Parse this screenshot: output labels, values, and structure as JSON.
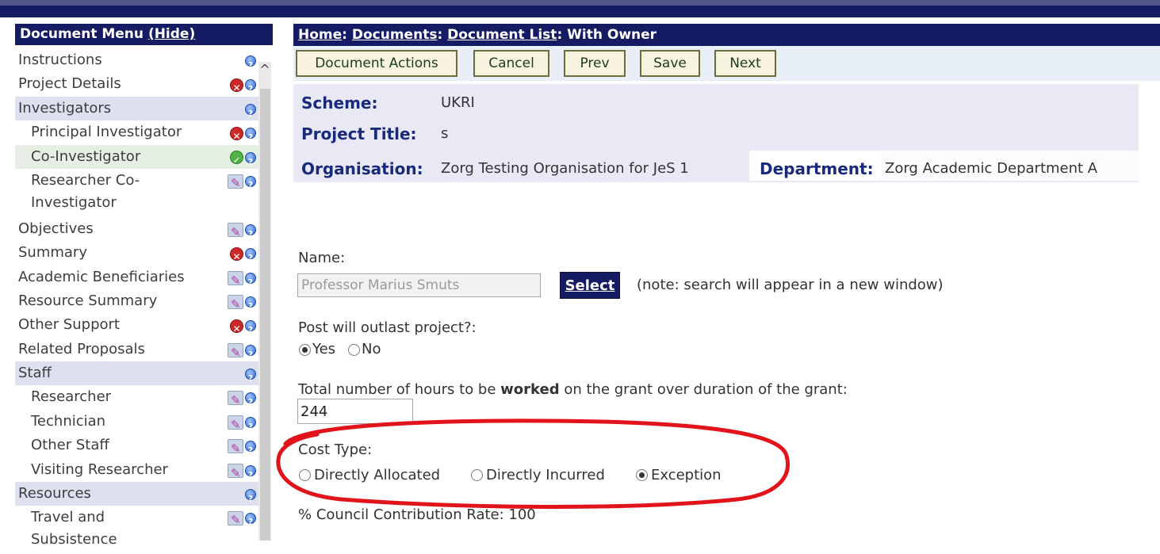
{
  "menu": {
    "header": "Document Menu",
    "hide_link": "(Hide)",
    "items": [
      {
        "label": "Instructions",
        "icons": [
          "help"
        ]
      },
      {
        "label": "Project Details",
        "icons": [
          "error",
          "help"
        ]
      },
      {
        "label": "Investigators",
        "icons": [
          "help"
        ]
      },
      {
        "label": "Principal Investigator",
        "icons": [
          "error",
          "help"
        ]
      },
      {
        "label": "Co-Investigator",
        "icons": [
          "ok",
          "help"
        ]
      },
      {
        "label": "Researcher Co-Investigator",
        "icons": [
          "edit",
          "help"
        ]
      },
      {
        "label": "Objectives",
        "icons": [
          "edit",
          "help"
        ]
      },
      {
        "label": "Summary",
        "icons": [
          "error",
          "help"
        ]
      },
      {
        "label": "Academic Beneficiaries",
        "icons": [
          "edit",
          "help"
        ]
      },
      {
        "label": "Resource Summary",
        "icons": [
          "edit",
          "help"
        ]
      },
      {
        "label": "Other Support",
        "icons": [
          "error",
          "help"
        ]
      },
      {
        "label": "Related Proposals",
        "icons": [
          "edit",
          "help"
        ]
      },
      {
        "label": "Staff",
        "icons": [
          "help"
        ]
      },
      {
        "label": "Researcher",
        "icons": [
          "edit",
          "help"
        ]
      },
      {
        "label": "Technician",
        "icons": [
          "edit",
          "help"
        ]
      },
      {
        "label": "Other Staff",
        "icons": [
          "edit",
          "help"
        ]
      },
      {
        "label": "Visiting Researcher",
        "icons": [
          "edit",
          "help"
        ]
      },
      {
        "label": "Resources",
        "icons": [
          "help"
        ]
      },
      {
        "label": "Travel and Subsistence",
        "icons": [
          "edit",
          "help"
        ]
      }
    ]
  },
  "breadcrumb": {
    "home": "Home",
    "documents": "Documents",
    "document_list": "Document List",
    "current": "With Owner",
    "sep": ": "
  },
  "toolbar": {
    "document_actions": "Document Actions",
    "cancel": "Cancel",
    "prev": "Prev",
    "save": "Save",
    "next": "Next"
  },
  "info": {
    "scheme_label": "Scheme:",
    "scheme_value": "UKRI",
    "title_label": "Project Title:",
    "title_value": "s",
    "org_label": "Organisation:",
    "org_value": "Zorg Testing Organisation for JeS 1",
    "dept_label": "Department:",
    "dept_value": "Zorg Academic Department A"
  },
  "form": {
    "name_label": "Name:",
    "name_value": "Professor Marius Smuts",
    "select_button": "Select",
    "select_note": "(note: search will appear in a new window)",
    "outlast_label": "Post will outlast project?:",
    "outlast_yes": "Yes",
    "outlast_no": "No",
    "outlast_selected": "Yes",
    "hours_label_before": "Total number of hours to be ",
    "hours_label_bold": "worked",
    "hours_label_after": " on the grant over duration of the grant:",
    "hours_value": "244",
    "cost_type_label": "Cost Type:",
    "cost_options": [
      "Directly Allocated",
      "Directly Incurred",
      "Exception"
    ],
    "cost_selected": "Exception",
    "council_rate": "% Council Contribution Rate: 100"
  },
  "colors": {
    "navy": "#161c63",
    "annotation": "#e0141a"
  }
}
